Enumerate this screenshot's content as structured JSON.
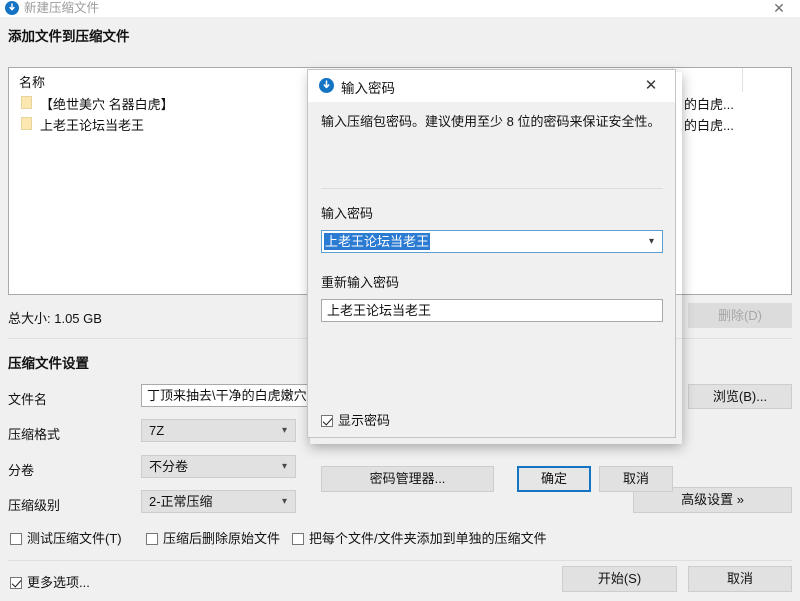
{
  "window": {
    "title": "新建压缩文件",
    "title_icon": "archive-arrow-icon",
    "close_label": "✕",
    "accent_color": "#1573c4"
  },
  "header": {
    "title": "添加文件到压缩文件"
  },
  "file_list": {
    "column_name": "名称",
    "rows": [
      {
        "icon": "folder-icon",
        "name": "【绝世美穴 名器白虎】",
        "trailing": "的白虎..."
      },
      {
        "icon": "folder-icon",
        "name": "上老王论坛当老王",
        "trailing": "的白虎..."
      }
    ]
  },
  "summary": {
    "total_size": "总大小: 1.05 GB",
    "delete_button": "删除(D)"
  },
  "settings": {
    "section_title": "压缩文件设置",
    "filename_label": "文件名",
    "filename_value": "丁顶来抽去\\干净的白虎嫩穴总",
    "browse_button": "浏览(B)...",
    "format_label": "压缩格式",
    "format_value": "7Z",
    "volume_label": "分卷",
    "volume_value": "不分卷",
    "level_label": "压缩级别",
    "level_value": "2-正常压缩",
    "advanced_button": "高级设置 »"
  },
  "options": {
    "test_archive": {
      "label": "测试压缩文件(T)",
      "checked": false
    },
    "delete_after": {
      "label": "压缩后删除原始文件",
      "checked": false
    },
    "separate_archives": {
      "label": "把每个文件/文件夹添加到单独的压缩文件",
      "checked": false
    },
    "more_options": {
      "label": "更多选项...",
      "checked": true
    }
  },
  "footer": {
    "start_button": "开始(S)",
    "cancel_button": "取消"
  },
  "password_dialog": {
    "title": "输入密码",
    "title_icon": "archive-arrow-icon",
    "close_label": "✕",
    "description": "输入压缩包密码。建议使用至少 8 位的密码来保证安全性。",
    "password_label": "输入密码",
    "password_value": "上老王论坛当老王",
    "confirm_label": "重新输入密码",
    "confirm_value": "上老王论坛当老王",
    "show_password": {
      "label": "显示密码",
      "checked": true
    },
    "manager_button": "密码管理器...",
    "ok_button": "确定",
    "cancel_button": "取消",
    "selection_color": "#2c7bd2"
  }
}
